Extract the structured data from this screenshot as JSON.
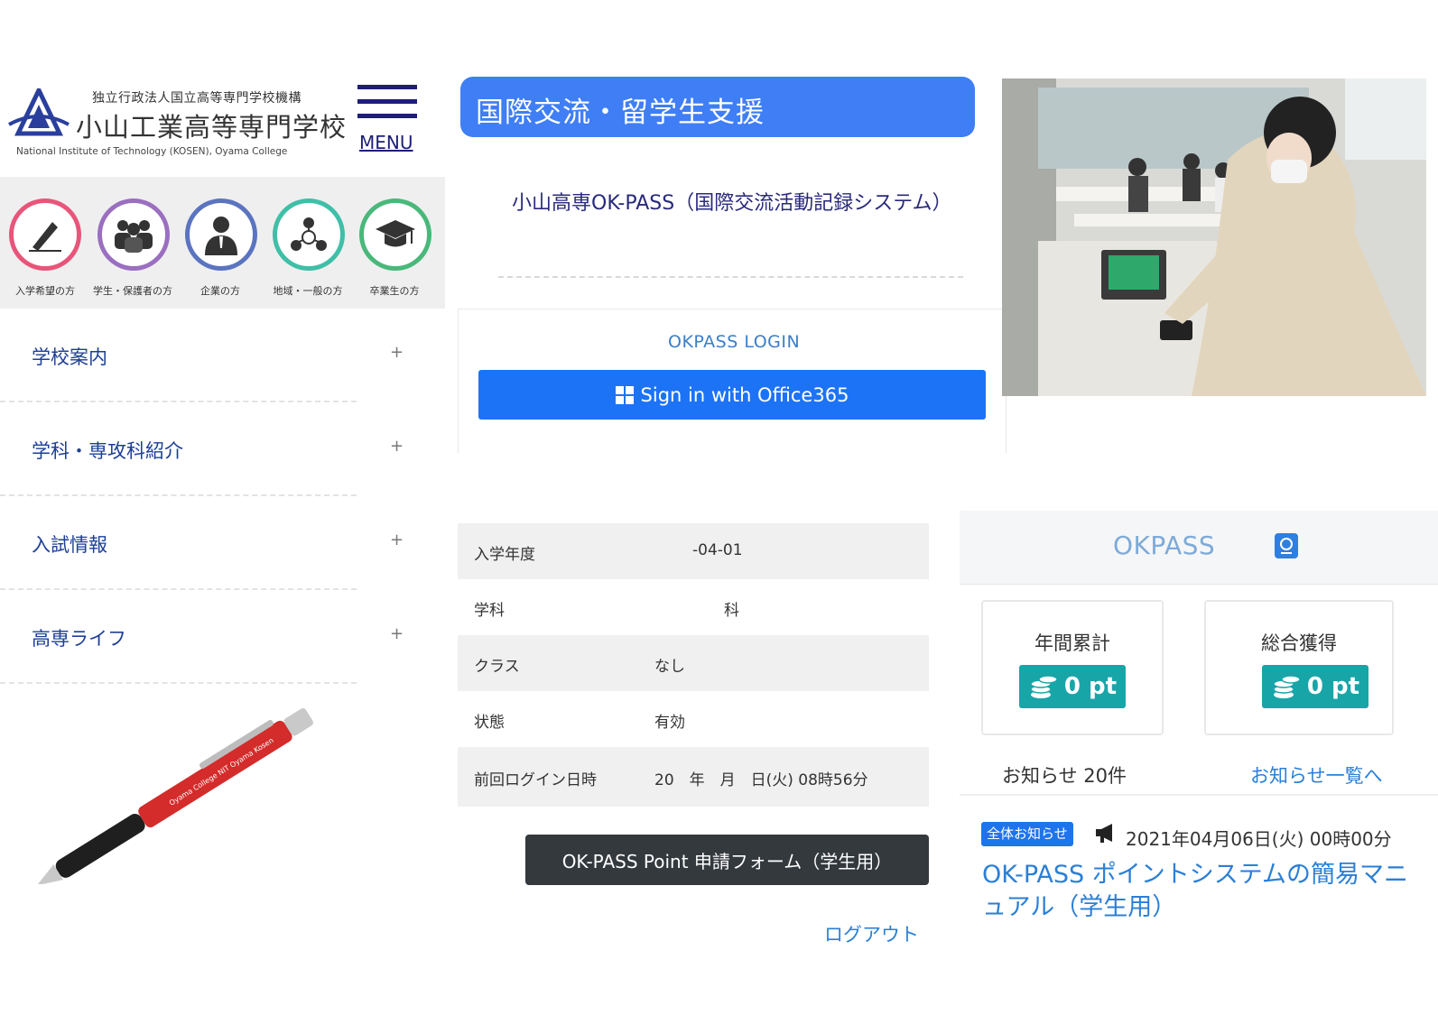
{
  "school": {
    "org_line": "独立行政法人国立高等専門学校機構",
    "name": "小山工業高等専門学校",
    "name_en": "National Institute of Technology (KOSEN), Oyama College",
    "menu_label": "MENU",
    "audience": [
      {
        "label": "入学希望の方",
        "color": "#e8557a",
        "icon": "pen-icon"
      },
      {
        "label": "学生・保護者の方",
        "color": "#9a6fc0",
        "icon": "group-icon"
      },
      {
        "label": "企業の方",
        "color": "#5b74c0",
        "icon": "businessperson-icon"
      },
      {
        "label": "地域・一般の方",
        "color": "#3fbfa7",
        "icon": "network-icon"
      },
      {
        "label": "卒業生の方",
        "color": "#49b87a",
        "icon": "graduation-cap-icon"
      }
    ],
    "nav": [
      {
        "label": "学校案内",
        "symbol": "+"
      },
      {
        "label": "学科・専攻科紹介",
        "symbol": "+"
      },
      {
        "label": "入試情報",
        "symbol": "+"
      },
      {
        "label": "高専ライフ",
        "symbol": "+"
      }
    ],
    "pen_text": "Oyama College NIT Oyama Kosen"
  },
  "okpass": {
    "banner": "国際交流・留学生支援",
    "system_title": "小山高専OK-PASS（国際交流活動記録システム）",
    "login_heading": "OKPASS LOGIN",
    "signin_label": "Sign in with Office365"
  },
  "profile": {
    "rows": [
      {
        "key": "入学年度",
        "value": "-04-01"
      },
      {
        "key": "学科",
        "value": "科"
      },
      {
        "key": "クラス",
        "value": "なし"
      },
      {
        "key": "状態",
        "value": "有効"
      },
      {
        "key": "前回ログイン日時",
        "value": "20　年　月　日(火) 08時56分"
      }
    ],
    "form_button": "OK-PASS Point 申請フォーム（学生用）",
    "logout": "ログアウト"
  },
  "points": {
    "brand": "OKPASS",
    "annual_label": "年間累計",
    "annual_value": "0 pt",
    "total_label": "総合獲得",
    "total_value": "0 pt",
    "notice_count": "お知らせ 20件",
    "notice_link": "お知らせ一覧へ",
    "notice": {
      "badge": "全体お知らせ",
      "date": "2021年04月06日(火) 00時00分",
      "title": "OK-PASS ポイントシステムの簡易マニュアル（学生用）"
    }
  },
  "photo_alt": "教室でICカードリーダーにカードをかざす学生"
}
